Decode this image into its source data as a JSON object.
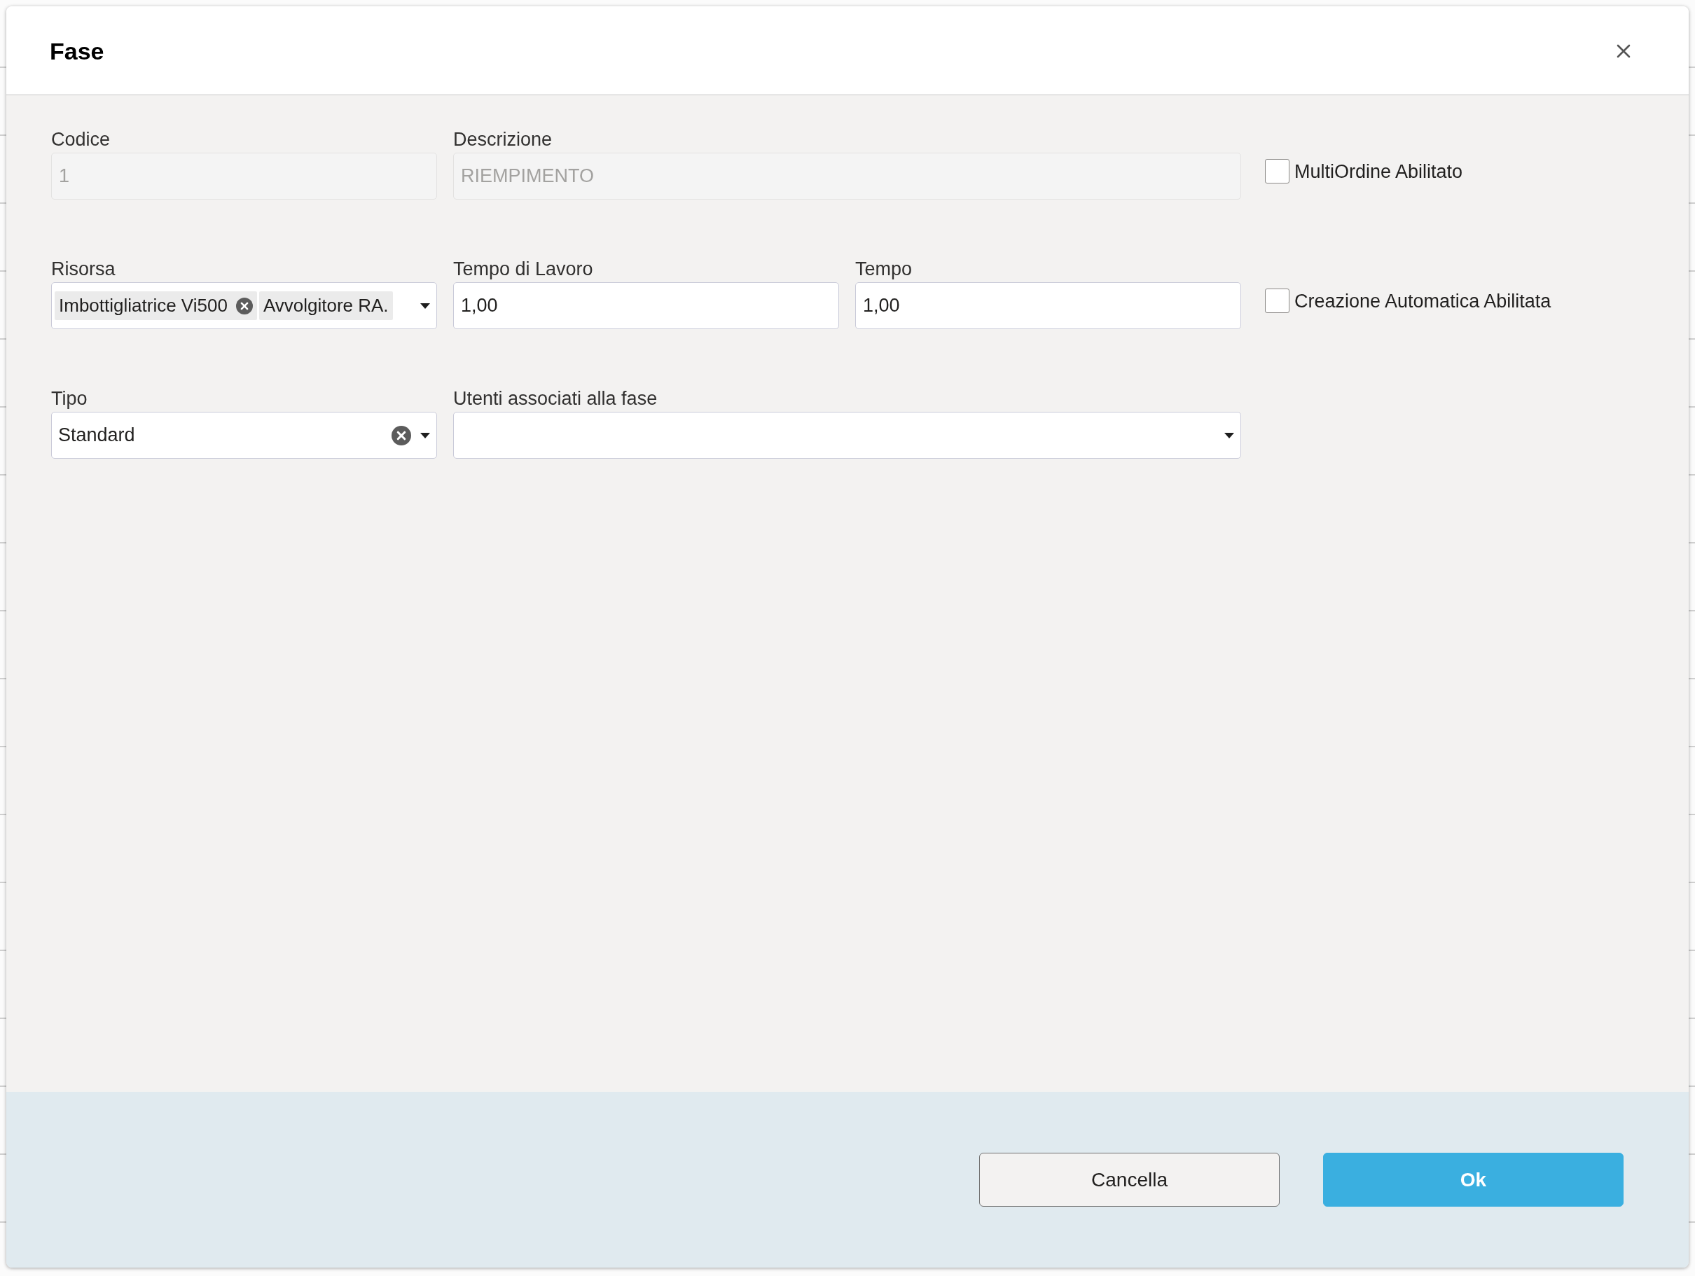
{
  "dialog": {
    "title": "Fase"
  },
  "rows": [
    {
      "fields": [
        {
          "kind": "text",
          "label": "Codice",
          "value": "1",
          "disabled": true
        },
        {
          "kind": "text",
          "label": "Descrizione",
          "value": "RIEMPIMENTO",
          "disabled": true
        },
        {
          "kind": "checkbox",
          "label": "MultiOrdine Abilitato",
          "checked": false
        }
      ]
    },
    {
      "fields": [
        {
          "kind": "multiselect",
          "label": "Risorsa",
          "chips": [
            {
              "label": "Imbottigliatrice Vi500",
              "removable": true
            },
            {
              "label": "Avvolgitore RA.",
              "removable": false
            }
          ]
        },
        {
          "kind": "text",
          "label": "Tempo di Lavoro",
          "value": "1,00",
          "disabled": false
        },
        {
          "kind": "text",
          "label": "Tempo",
          "value": "1,00",
          "disabled": false
        },
        {
          "kind": "checkbox",
          "label": "Creazione Automatica Abilitata",
          "checked": false
        }
      ]
    },
    {
      "fields": [
        {
          "kind": "select",
          "label": "Tipo",
          "value": "Standard"
        },
        {
          "kind": "select",
          "label": "Utenti associati alla fase"
        }
      ]
    }
  ],
  "buttons": [
    {
      "kind": "secondary",
      "label": "Cancella"
    },
    {
      "kind": "primary",
      "label": "Ok"
    }
  ]
}
